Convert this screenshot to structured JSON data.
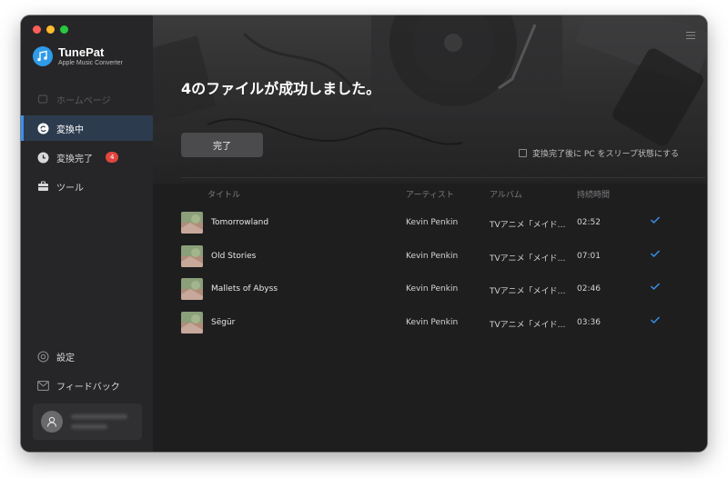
{
  "app": {
    "name": "TunePat",
    "subtitle": "Apple Music Converter"
  },
  "sidebar": {
    "items": [
      {
        "label": "ホームページ",
        "icon": "home-icon",
        "state": "disabled"
      },
      {
        "label": "変換中",
        "icon": "converting-icon",
        "state": "active"
      },
      {
        "label": "変換完了",
        "icon": "clock-icon",
        "badge": "4"
      },
      {
        "label": "ツール",
        "icon": "toolbox-icon"
      }
    ],
    "bottom": [
      {
        "label": "設定",
        "icon": "gear-icon"
      },
      {
        "label": "フィードバック",
        "icon": "mail-icon"
      }
    ]
  },
  "main": {
    "title": "4のファイルが成功しました。",
    "done_button": "完了",
    "sleep_option": "変換完了後に PC をスリープ状態にする",
    "sleep_checked": false,
    "columns": [
      "タイトル",
      "アーティスト",
      "アルバム",
      "持続時間"
    ],
    "rows": [
      {
        "title": "Tomorrowland",
        "artist": "Kevin Penkin",
        "album": "TVアニメ「メイド…",
        "duration": "02:52"
      },
      {
        "title": "Old Stories",
        "artist": "Kevin Penkin",
        "album": "TVアニメ「メイド…",
        "duration": "07:01"
      },
      {
        "title": "Mallets of Abyss",
        "artist": "Kevin Penkin",
        "album": "TVアニメ「メイド…",
        "duration": "02:46"
      },
      {
        "title": "Sëgür",
        "artist": "Kevin Penkin",
        "album": "TVアニメ「メイド…",
        "duration": "03:36"
      }
    ]
  },
  "colors": {
    "accent": "#3d8ef0",
    "badge": "#e0463f",
    "check": "#3a8ee6",
    "sidebar_bg": "#262628",
    "main_bg": "#1e1e1f"
  }
}
